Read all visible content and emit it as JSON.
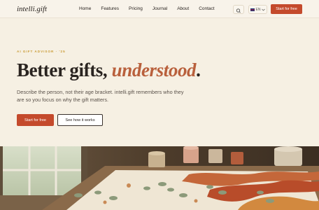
{
  "brand": {
    "logo": "intelli.gift"
  },
  "nav": {
    "links": [
      "Home",
      "Features",
      "Pricing",
      "Journal",
      "About",
      "Contact"
    ],
    "language": "EN",
    "cta": "Start for free"
  },
  "hero": {
    "eyebrow": "AI GIFT ADVISOR · '25",
    "headline_main": "Better gifts,",
    "headline_accent": "understood",
    "headline_end": ".",
    "subtitle": "Describe the person, not their age bracket. intelli.gift remembers who they are so you focus on why the gift matters.",
    "primary_button": "Start for free",
    "secondary_button": "See how it works"
  },
  "colors": {
    "accent": "#c44a2c",
    "headline_accent": "#b9603c",
    "eyebrow": "#c99a32",
    "background": "#f6f0e3"
  },
  "icons": {
    "search": "search-icon",
    "language_chevron": "chevron-down-icon",
    "flag": "flag-icon"
  }
}
